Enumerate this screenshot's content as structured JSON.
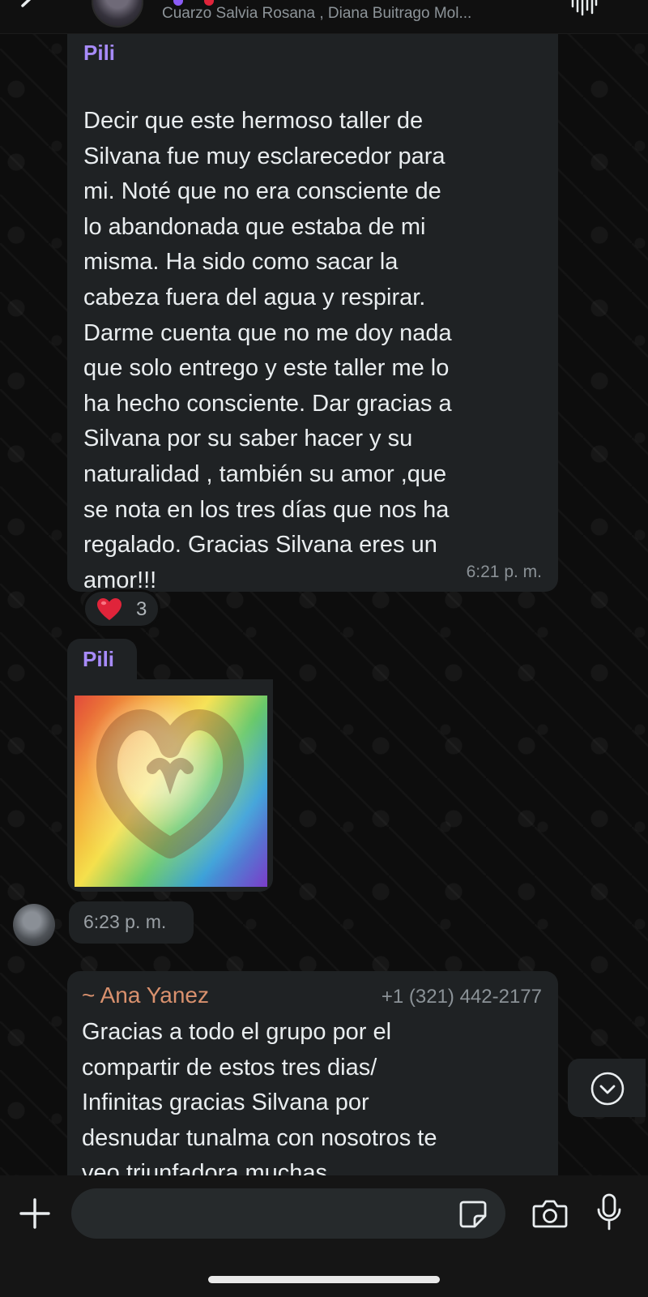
{
  "header": {
    "members": "Cuarzo Salvia Rosana , Diana Buitrago Mol..."
  },
  "messages": [
    {
      "sender": "Pili",
      "text": "Decir que este hermoso taller de\nSilvana fue muy esclarecedor para\nmi. Noté que no era consciente de\nlo abandonada que estaba de mi\nmisma. Ha sido como sacar la\ncabeza fuera del agua y respirar.\nDarme cuenta que no me doy nada\nque solo entrego y este taller me lo\nha hecho consciente. Dar gracias a\nSilvana por su saber hacer y su\nnaturalidad , también su amor ,que\nse nota en los tres días que nos ha\nregalado. Gracias Silvana eres un\namor!!!",
      "time": "6:21 p. m.",
      "reaction": {
        "emoji": "heart",
        "count": "3"
      }
    },
    {
      "sender": "Pili",
      "type": "image",
      "image_subject": "rainbow-heart-hands",
      "time": "6:23 p. m."
    },
    {
      "sender": "~ Ana Yanez",
      "phone": "+1 (321) 442-2177",
      "text": "Gracias a todo el grupo por el\ncompartir de estos tres dias/\nInfinitas gracias Silvana por\ndesnudar tunalma con nosotros te\nveo triunfadora muchas"
    }
  ],
  "composer": {
    "placeholder": ""
  },
  "icons": {
    "back": "chevron-left-icon",
    "audio": "audio-wave-icon",
    "scroll": "chevron-down-circle-icon",
    "attach": "plus-icon",
    "sticker": "sticker-icon",
    "camera": "camera-icon",
    "mic": "microphone-icon"
  },
  "colors": {
    "sender_pili": "#a78bfa",
    "sender_ana": "#d9916e",
    "bubble": "#1f2224",
    "heart": "#e0243a"
  }
}
